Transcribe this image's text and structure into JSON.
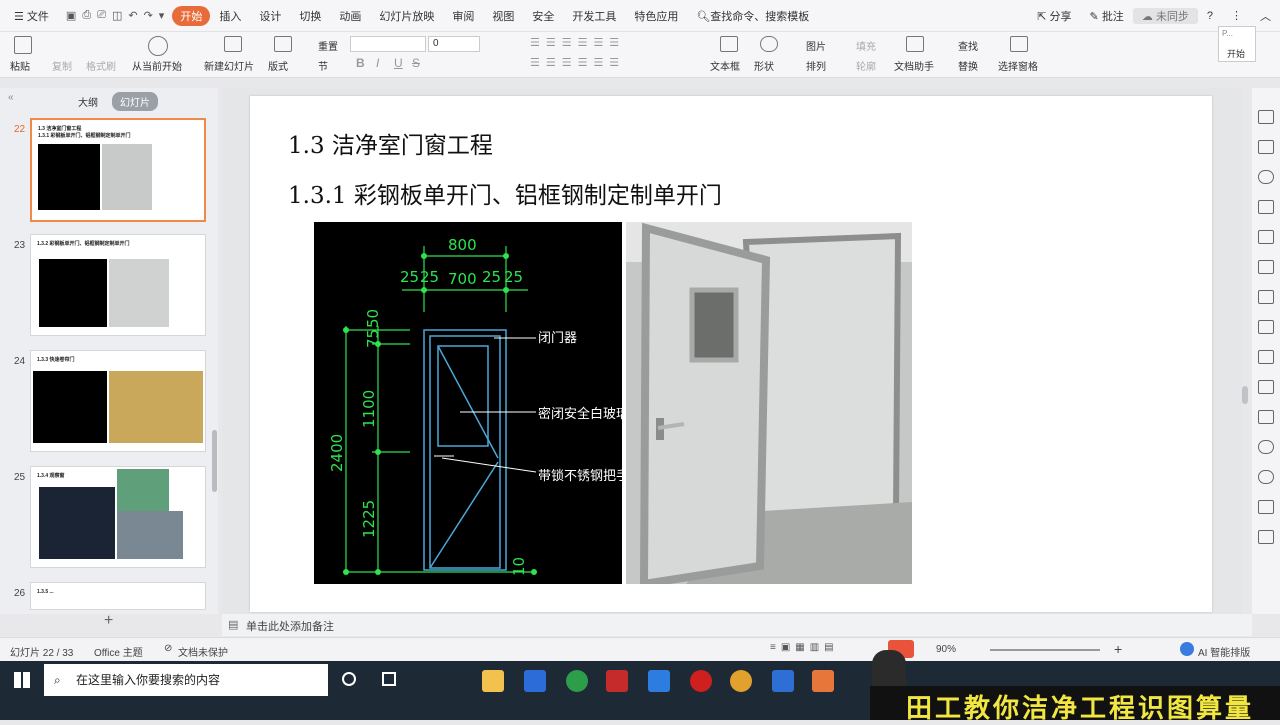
{
  "menu": {
    "file": "文件",
    "tabs": [
      "开始",
      "插入",
      "设计",
      "切换",
      "动画",
      "幻灯片放映",
      "审阅",
      "视图",
      "安全",
      "开发工具",
      "特色应用"
    ],
    "search": "查找命令、搜索模板",
    "share": "分享",
    "comment": "批注",
    "sync": "未同步"
  },
  "toolbar": {
    "paste": "粘贴",
    "copy": "复制",
    "format_painter": "格式刷",
    "play_current": "从当前开始",
    "new_slide": "新建幻灯片",
    "layout": "版式",
    "reset": "重置",
    "section": "节",
    "font_size": "0",
    "textbox": "文本框",
    "shape": "形状",
    "picture": "图片",
    "fill": "填充",
    "arrange": "排列",
    "outline": "轮廓",
    "doc_helper": "文档助手",
    "find": "查找",
    "replace": "替换",
    "select_pane": "选择窗格",
    "popup_title": "P...",
    "popup_btn": "开始"
  },
  "sidebar": {
    "tab_outline": "大纲",
    "tab_slides": "幻灯片",
    "thumbs": [
      {
        "num": "22",
        "title": "1.3 洁净室门窗工程\n1.3.1 彩钢板单开门、铝框钢制定制单开门"
      },
      {
        "num": "23",
        "title": "1.3.2 彩钢板单开门、铝框钢制定制单开门"
      },
      {
        "num": "24",
        "title": "1.3.3 快速卷帘门"
      },
      {
        "num": "25",
        "title": "1.3.4 观察窗"
      },
      {
        "num": "26",
        "title": "1.3.5 ..."
      }
    ]
  },
  "slide": {
    "title": "1.3 洁净室门窗工程",
    "subtitle": "1.3.1 彩钢板单开门、铝框钢制定制单开门"
  },
  "drawing": {
    "dim_800": "800",
    "dim_25a": "25",
    "dim_25b": "25",
    "dim_700": "700",
    "dim_25c": "25",
    "dim_25d": "25",
    "dim_75": "75",
    "dim_50": "50",
    "dim_1100": "1100",
    "dim_2400": "2400",
    "dim_1225": "1225",
    "dim_10": "10",
    "label_closer": "闭门器",
    "label_glass": "密闭安全白玻璃",
    "label_handle": "带锁不锈钢把手"
  },
  "notes": {
    "placeholder": "单击此处添加备注"
  },
  "status": {
    "slide_count": "幻灯片 22 / 33",
    "theme": "Office 主题",
    "protect": "文档未保护",
    "zoom": "90%",
    "ai": "AI 智能排版"
  },
  "taskbar": {
    "search_placeholder": "在这里输入你要搜索的内容"
  },
  "banner": {
    "text": "田工教你洁净工程识图算量"
  }
}
